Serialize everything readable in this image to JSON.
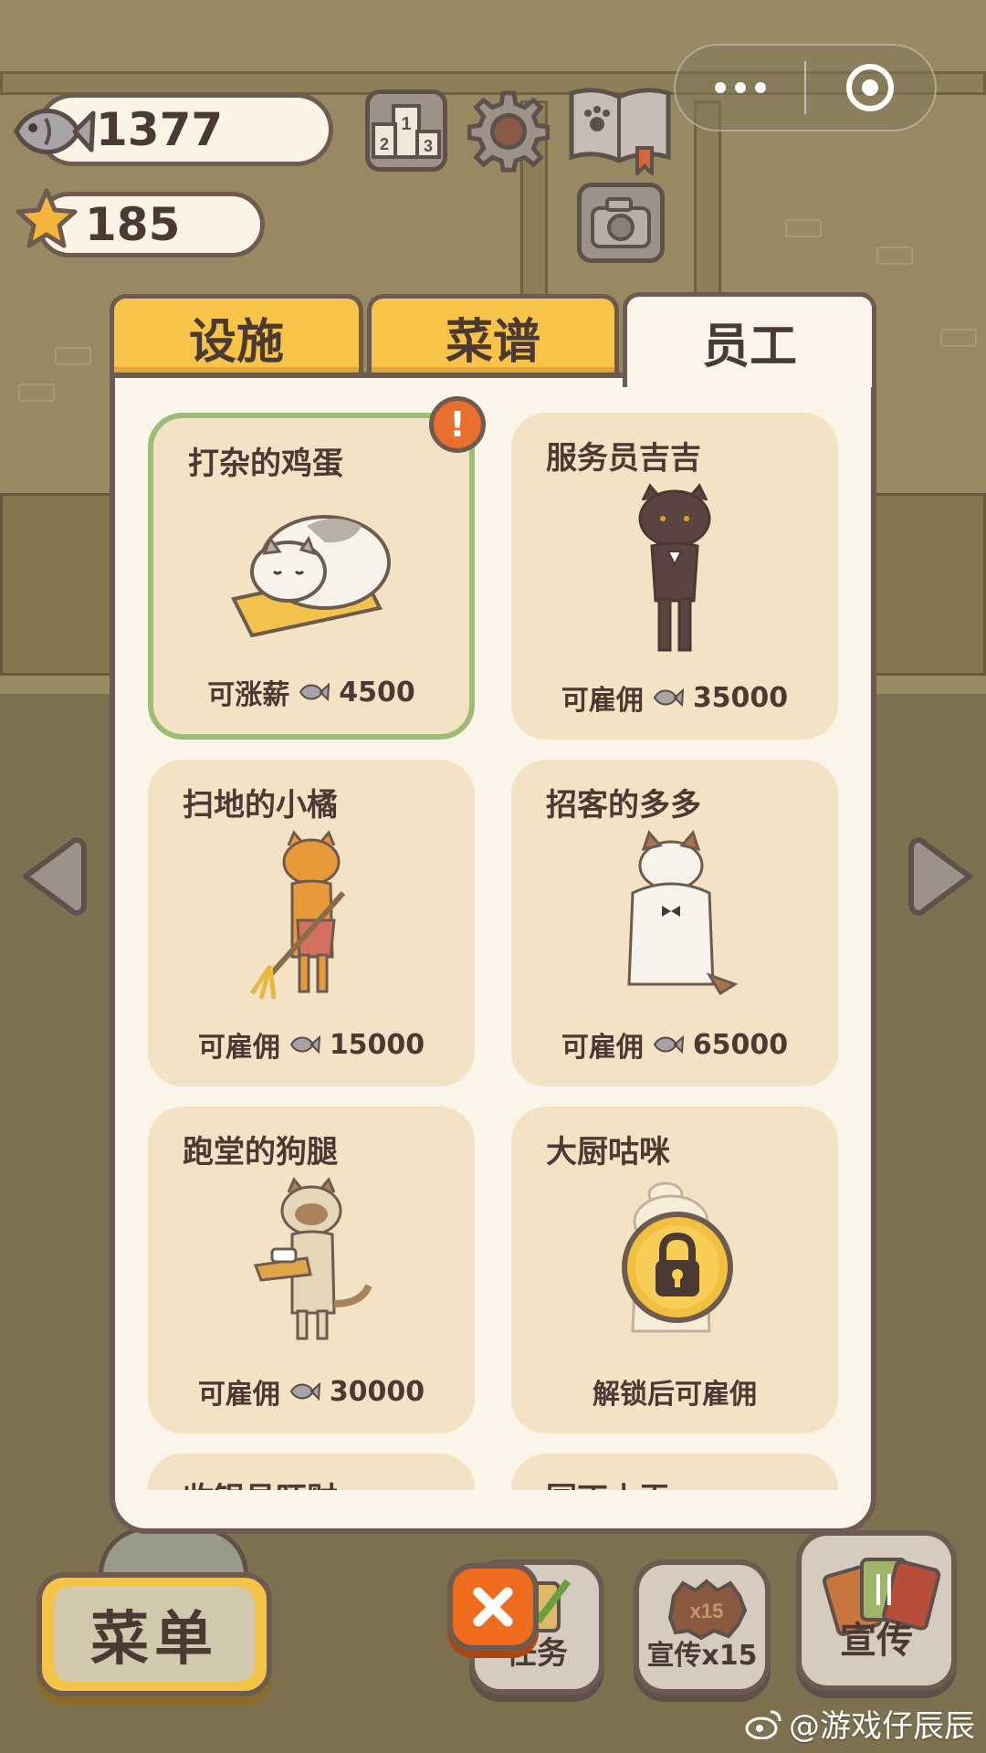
{
  "hud": {
    "fish_count": "1377",
    "star_count": "185"
  },
  "tabs": [
    {
      "label": "设施",
      "active": false
    },
    {
      "label": "菜谱",
      "active": false
    },
    {
      "label": "员工",
      "active": true
    }
  ],
  "staff": [
    {
      "name": "打杂的鸡蛋",
      "status": "可涨薪",
      "price": "4500",
      "selected": true,
      "alert": "!"
    },
    {
      "name": "服务员吉吉",
      "status": "可雇佣",
      "price": "35000"
    },
    {
      "name": "扫地的小橘",
      "status": "可雇佣",
      "price": "15000"
    },
    {
      "name": "招客的多多",
      "status": "可雇佣",
      "price": "65000"
    },
    {
      "name": "跑堂的狗腿",
      "status": "可雇佣",
      "price": "30000"
    },
    {
      "name": "大厨咕咪",
      "status": "解锁后可雇佣",
      "locked": true
    },
    {
      "name": "收银员旺财"
    },
    {
      "name": "园丁小王"
    }
  ],
  "bottom": {
    "menu_label": "菜单",
    "tasks_label": "任务",
    "promo15_label": "宣传x15",
    "promo15_badge": "x15",
    "promo_label": "宣传"
  },
  "ranking_digits": [
    "1",
    "2",
    "3"
  ],
  "watermark": "@游戏仔辰辰",
  "colors": {
    "tab_yellow": "#f7c449",
    "panel_bg": "#fbf4e8",
    "card_bg": "#f3e3c4",
    "selected_border": "#9bbd76",
    "alert_orange": "#e76e2c",
    "outline": "#6d5a50"
  }
}
